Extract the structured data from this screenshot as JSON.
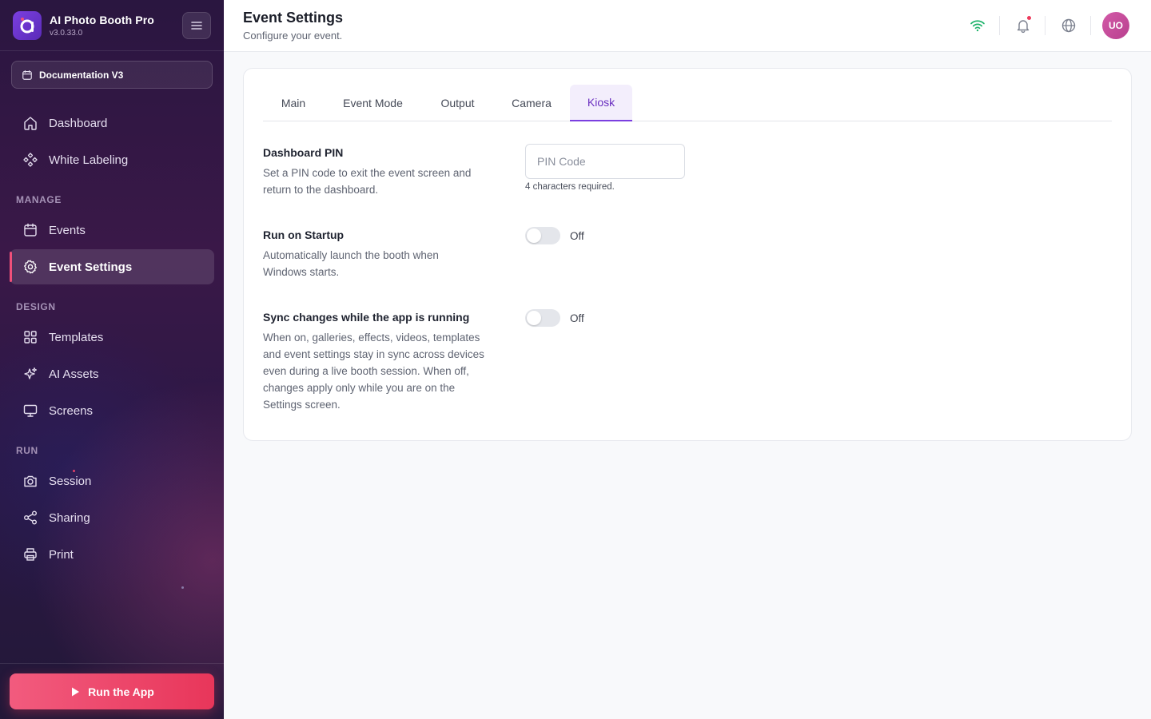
{
  "app": {
    "name": "AI Photo Booth Pro",
    "version": "v3.0.33.0"
  },
  "event": {
    "name": "Documentation V3"
  },
  "nav": {
    "dashboard": "Dashboard",
    "white_labeling": "White Labeling",
    "manage_label": "MANAGE",
    "events": "Events",
    "event_settings": "Event Settings",
    "design_label": "DESIGN",
    "templates": "Templates",
    "ai_assets": "AI Assets",
    "screens": "Screens",
    "run_label": "RUN",
    "session": "Session",
    "sharing": "Sharing",
    "print": "Print",
    "active": "Event Settings"
  },
  "run_button": "Run the App",
  "header": {
    "title": "Event Settings",
    "subtitle": "Configure your event.",
    "avatar_initials": "UO",
    "icons": [
      "wifi-icon",
      "bell-icon",
      "globe-icon"
    ],
    "has_notification": true
  },
  "tabs": [
    "Main",
    "Event Mode",
    "Output",
    "Camera",
    "Kiosk"
  ],
  "active_tab": "Kiosk",
  "settings": {
    "pin": {
      "title": "Dashboard PIN",
      "description": "Set a PIN code to exit the event screen and return to the dashboard.",
      "value": "",
      "placeholder": "PIN Code",
      "hint": "4 characters required."
    },
    "startup": {
      "title": "Run on Startup",
      "description": "Automatically launch the booth when Windows starts.",
      "enabled": false,
      "state_label": "Off"
    },
    "sync": {
      "title": "Sync changes while the app is running",
      "description": "When on, galleries, effects, videos, templates and event settings stay in sync across devices even during a live booth session. When off, changes apply only while you are on the Settings screen.",
      "enabled": false,
      "state_label": "Off"
    }
  },
  "colors": {
    "accent": "#7b3fe0",
    "run_button": "#e8365a",
    "wifi": "#1fb36b",
    "notification": "#ee3a5c"
  }
}
